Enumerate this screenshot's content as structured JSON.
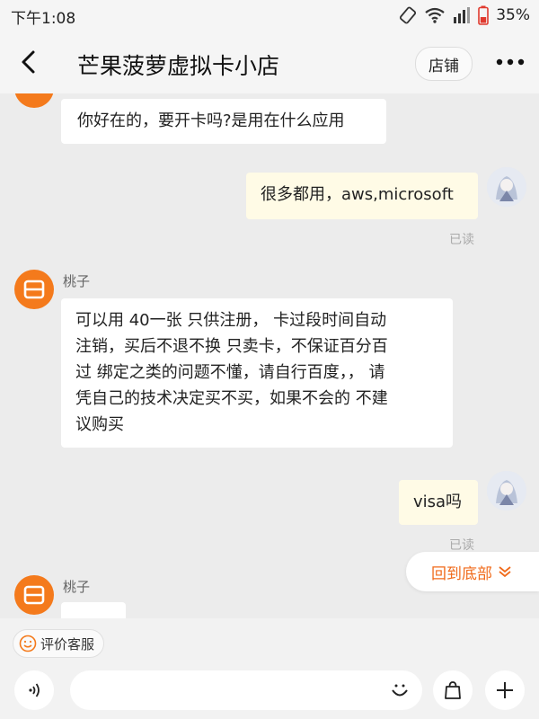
{
  "status_bar": {
    "time": "下午1:08",
    "battery": "35%",
    "icons": [
      "rotate-icon",
      "wifi-icon",
      "signal-icon",
      "battery-icon"
    ]
  },
  "header": {
    "title": "芒果菠萝虚拟卡小店",
    "store_label": "店铺",
    "icons": [
      "back-arrow-icon",
      "more-dots-icon"
    ]
  },
  "chat": {
    "messages": [
      {
        "side": "left",
        "text": "你好在的，要开卡吗?是用在什么应用"
      },
      {
        "side": "right",
        "text": "很多都用，aws,microsoft",
        "status": "已读"
      },
      {
        "side": "left",
        "sender": "桃子",
        "lines": [
          "可以用  40一张  只供注册，  卡过段时间自动",
          "注销，买后不退不换 只卖卡，不保证百分百",
          "过  绑定之类的问题不懂，请自行百度，，  请",
          "凭自己的技术决定买不买，如果不会的 不建",
          "议购买"
        ]
      },
      {
        "side": "right",
        "text": "visa吗",
        "status": "已读"
      },
      {
        "side": "left",
        "sender": "桃子",
        "text": ""
      }
    ],
    "scroll_bottom_label": "回到底部"
  },
  "quick_bar": {
    "rate_service_label": "评价客服"
  },
  "input_bar": {
    "placeholder": ""
  },
  "colors": {
    "accent_orange": "#f47a1c",
    "scroll_button_text": "#f06a1a",
    "my_bubble": "#fffbe6",
    "background": "#ececec"
  }
}
